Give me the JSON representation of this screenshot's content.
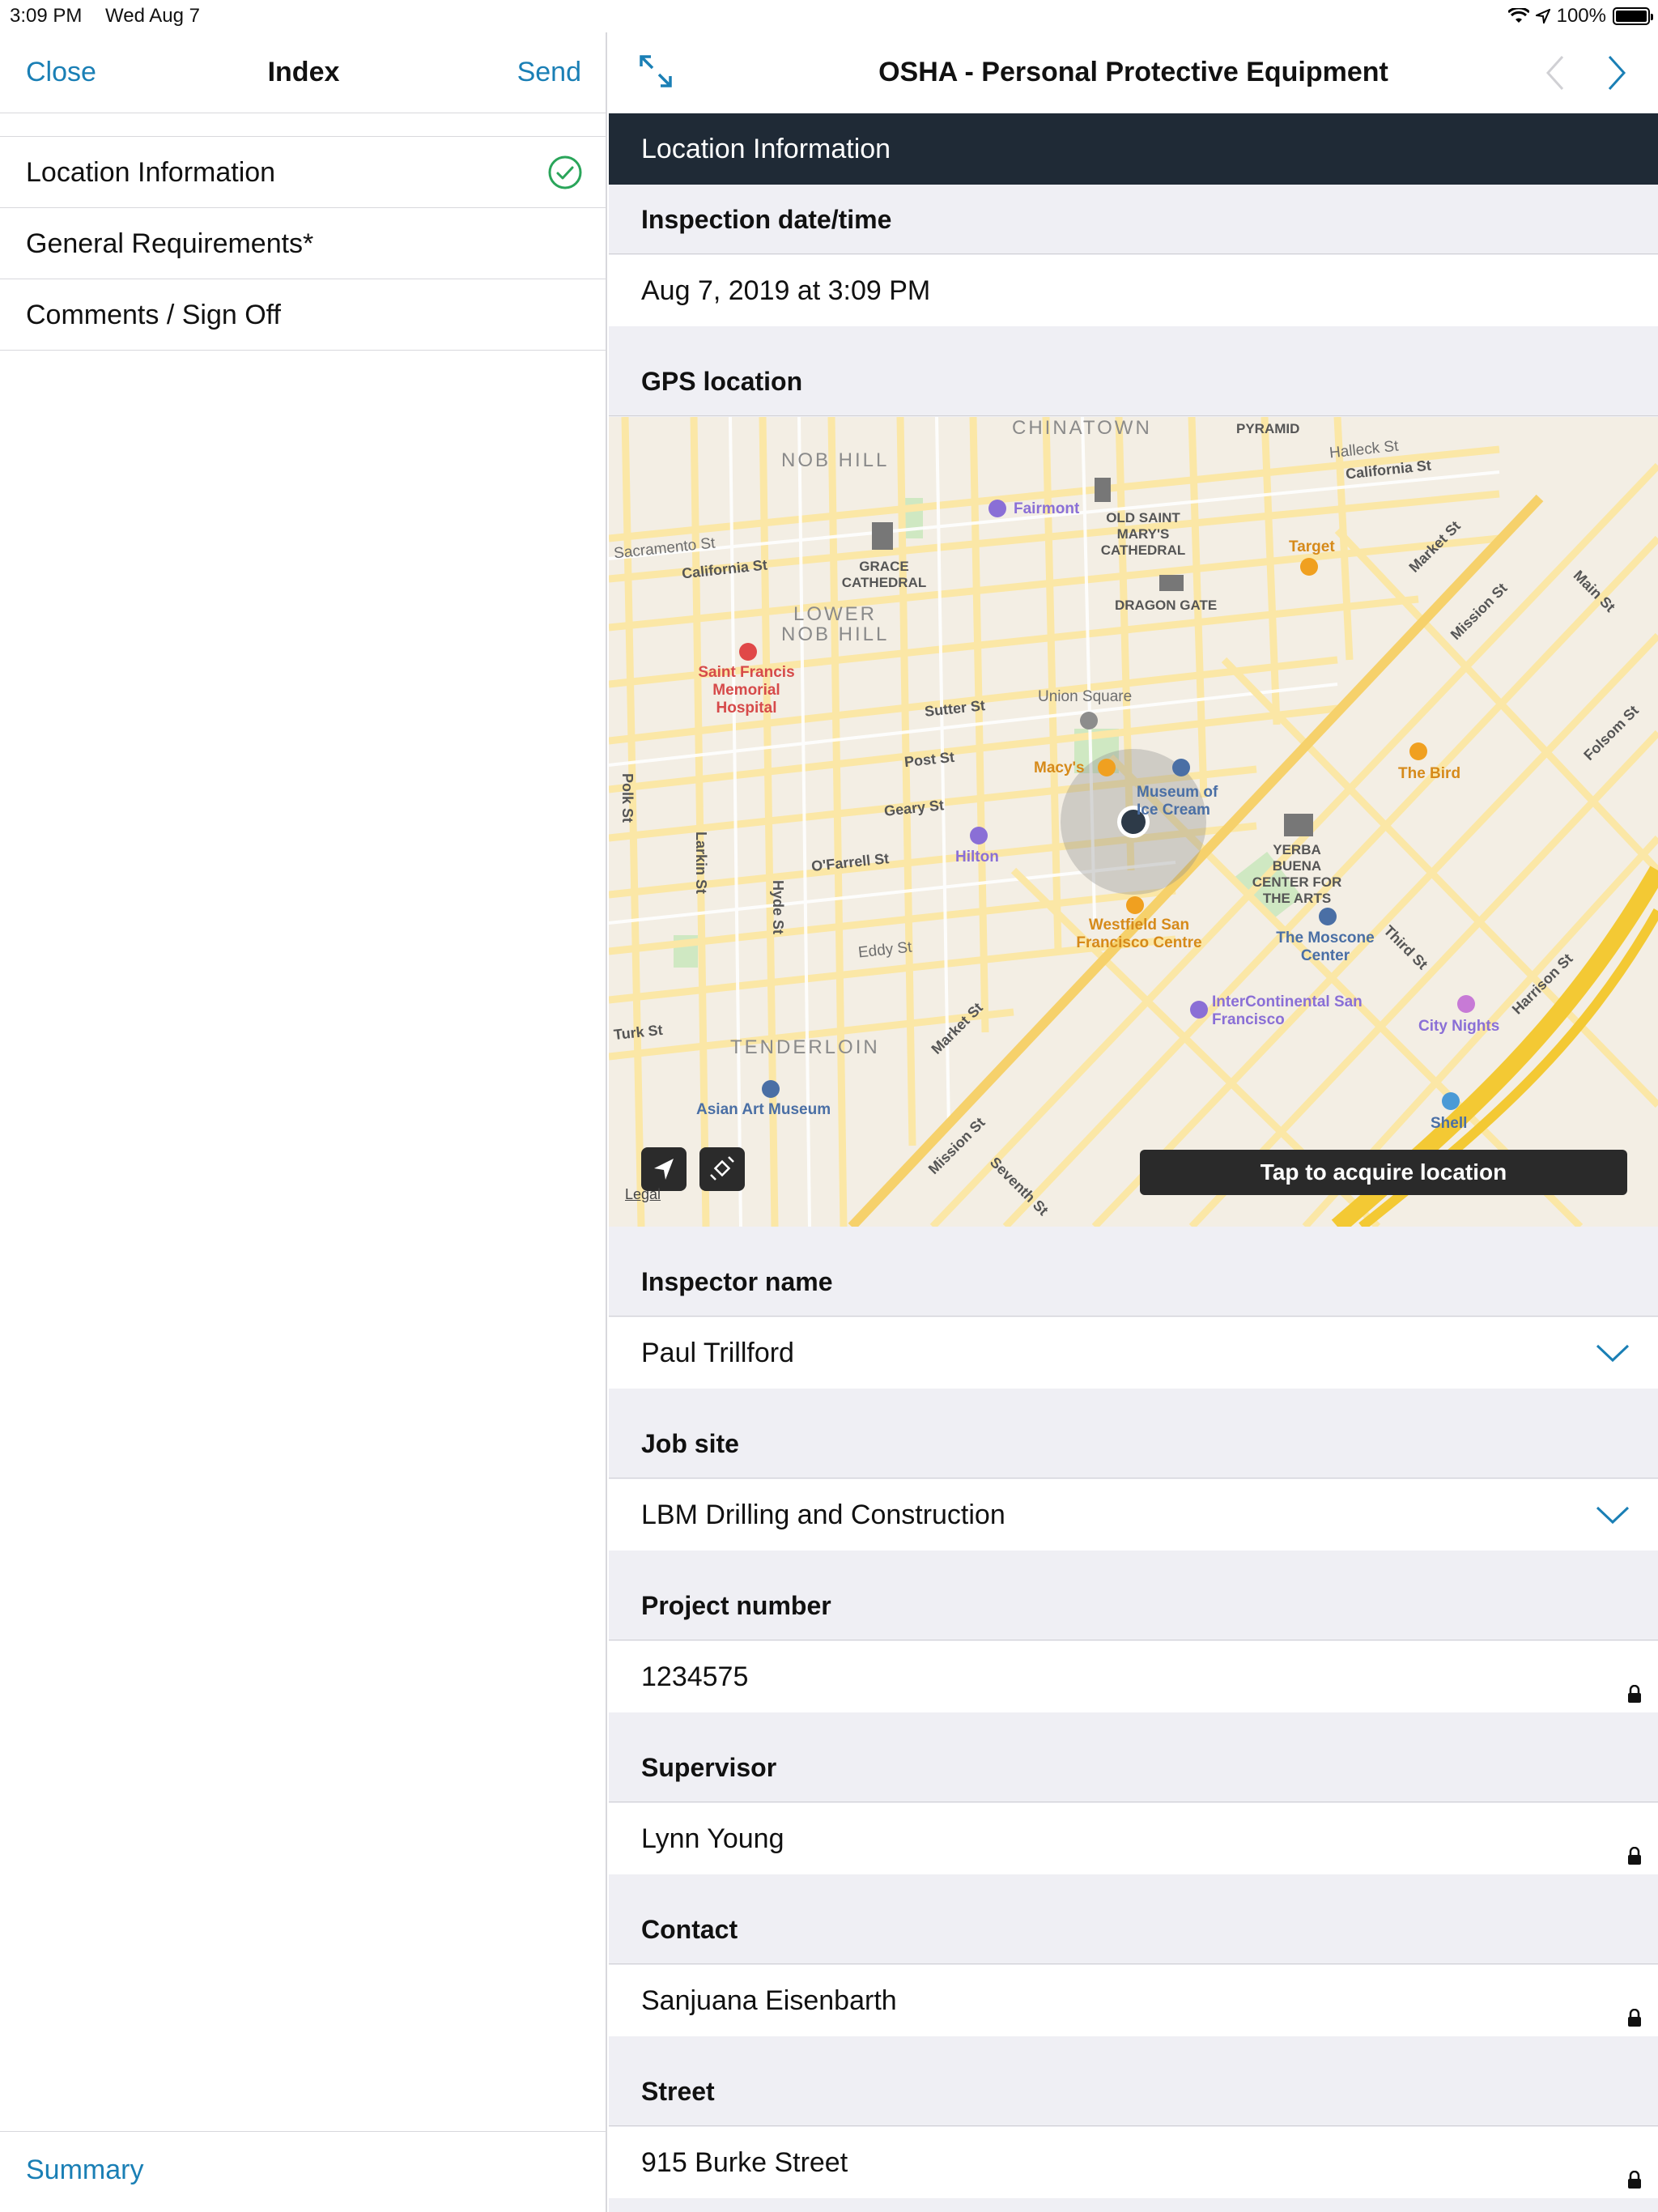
{
  "status": {
    "time": "3:09 PM",
    "date": "Wed Aug 7",
    "battery": "100%"
  },
  "sidebar": {
    "close_label": "Close",
    "title": "Index",
    "send_label": "Send",
    "items": [
      {
        "label": "Location Information",
        "complete": true
      },
      {
        "label": "General Requirements*",
        "complete": false
      },
      {
        "label": "Comments / Sign Off",
        "complete": false
      }
    ],
    "summary_label": "Summary"
  },
  "main": {
    "title": "OSHA - Personal Protective Equipment",
    "section": "Location Information",
    "fields": {
      "inspection_date": {
        "label": "Inspection date/time",
        "value": "Aug 7, 2019 at 3:09 PM"
      },
      "gps": {
        "label": "GPS location"
      },
      "inspector": {
        "label": "Inspector name",
        "value": "Paul Trillford"
      },
      "job_site": {
        "label": "Job site",
        "value": "LBM Drilling and Construction"
      },
      "project_number": {
        "label": "Project number",
        "value": "1234575"
      },
      "supervisor": {
        "label": "Supervisor",
        "value": "Lynn Young"
      },
      "contact": {
        "label": "Contact",
        "value": "Sanjuana Eisenbarth"
      },
      "street": {
        "label": "Street",
        "value": "915 Burke Street"
      }
    }
  },
  "map": {
    "acquire_label": "Tap to acquire location",
    "legal_label": "Legal",
    "labels": {
      "chinatown": "CHINATOWN",
      "nob_hill": "NOB HILL",
      "lower_nob_hill_1": "LOWER",
      "lower_nob_hill_2": "NOB HILL",
      "tenderloin": "TENDERLOIN",
      "pyramid": "PYRAMID",
      "fairmont": "Fairmont",
      "old_saint_marys": "OLD SAINT MARY'S CATHEDRAL",
      "grace_cathedral": "GRACE CATHEDRAL",
      "dragon_gate": "DRAGON GATE",
      "target": "Target",
      "saint_francis": "Saint Francis Memorial Hospital",
      "union_square": "Union Square",
      "macys": "Macy's",
      "museum_ice_cream": "Museum of Ice Cream",
      "hilton": "Hilton",
      "the_bird": "The Bird",
      "yerba_buena": "YERBA BUENA CENTER FOR THE ARTS",
      "westfield": "Westfield San Francisco Centre",
      "moscone": "The Moscone Center",
      "intercontinental": "InterContinental San Francisco",
      "city_nights": "City Nights",
      "asian_art": "Asian Art Museum",
      "shell": "Shell",
      "california_st_1": "California St",
      "california_st_2": "California St",
      "sacramento_st": "Sacramento St",
      "sutter_st": "Sutter St",
      "post_st": "Post St",
      "geary_st": "Geary St",
      "ofarrell_st": "O'Farrell St",
      "eddy_st": "Eddy St",
      "turk_st": "Turk St",
      "polk_st": "Polk St",
      "larkin_st": "Larkin St",
      "hyde_st": "Hyde St",
      "market_st_1": "Market St",
      "market_st_2": "Market St",
      "mission_st_1": "Mission St",
      "mission_st_2": "Mission St",
      "third_st": "Third St",
      "harrison_st": "Harrison St",
      "folsom_st": "Folsom St",
      "halleck_st": "Halleck St",
      "main_st": "Main St",
      "seventh_st": "Seventh St"
    }
  }
}
